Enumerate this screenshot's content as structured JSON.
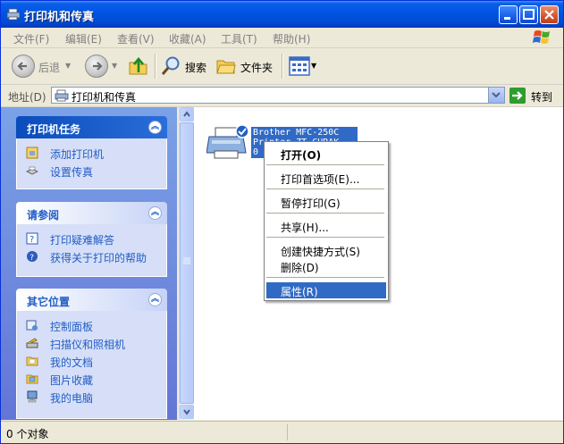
{
  "window": {
    "title": "打印机和传真"
  },
  "menu": [
    "文件(F)",
    "编辑(E)",
    "查看(V)",
    "收藏(A)",
    "工具(T)",
    "帮助(H)"
  ],
  "toolbar": {
    "back": "后退",
    "search": "搜索",
    "folders": "文件夹"
  },
  "address": {
    "label": "地址(D)",
    "value": "打印机和传真",
    "go": "转到"
  },
  "panels": [
    {
      "title": "打印机任务",
      "items": [
        "添加打印机",
        "设置传真"
      ]
    },
    {
      "title": "请参阅",
      "items": [
        "打印疑难解答",
        "获得关于打印的帮助"
      ]
    },
    {
      "title": "其它位置",
      "items": [
        "控制面板",
        "扫描仪和照相机",
        "我的文档",
        "图片收藏",
        "我的电脑"
      ]
    }
  ],
  "printer": {
    "name_lines": [
      "Brother MFC-250C",
      "Printer ZT CURAK",
      "0"
    ]
  },
  "context_menu": {
    "items": [
      "打开(O)",
      "打印首选项(E)...",
      "暂停打印(G)",
      "共享(H)...",
      "创建快捷方式(S)",
      "删除(D)",
      "属性(R)"
    ]
  },
  "status": {
    "text": "0 个对象"
  },
  "colors": {
    "title_bar": "#0054e3",
    "task_pane": "#6375d6",
    "selection": "#316ac5"
  }
}
